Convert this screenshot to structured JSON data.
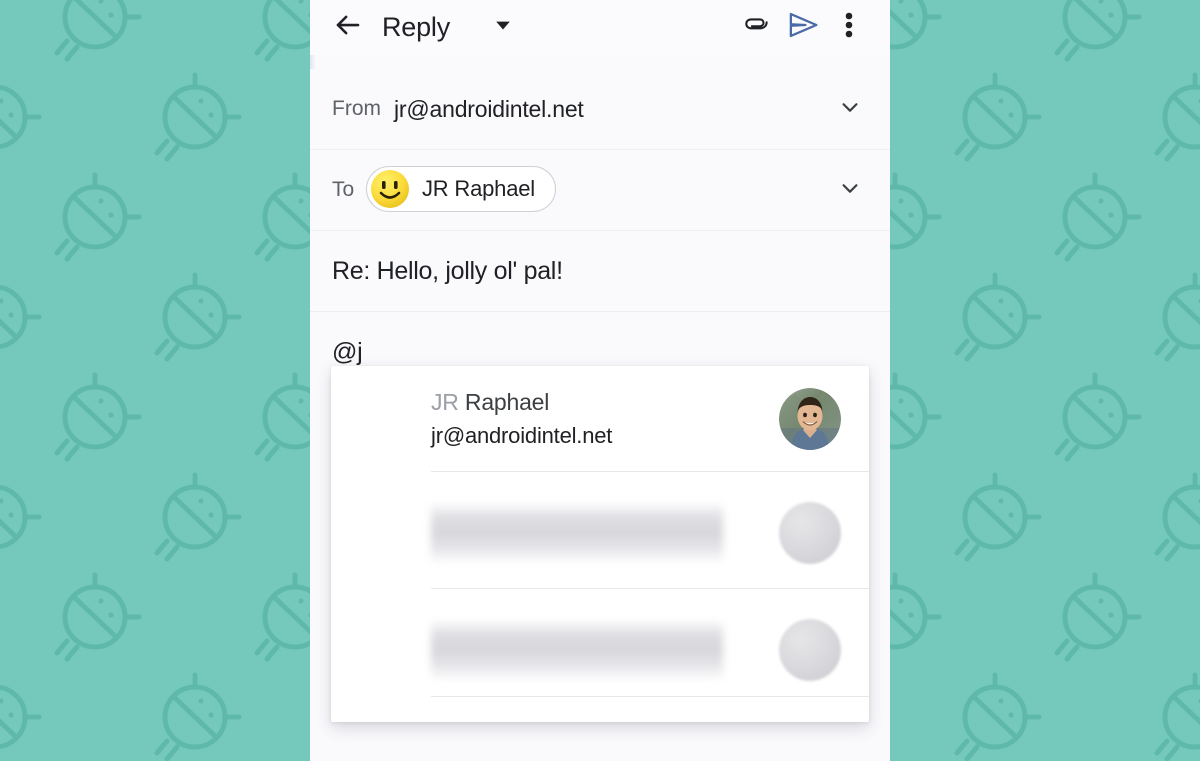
{
  "background": {
    "color": "#74c9bc",
    "pattern_icon": "android-bug-head-icon",
    "pattern_icon_color": "#5fb9ab"
  },
  "appbar": {
    "back_icon": "arrow-left-icon",
    "title": "Reply",
    "reply_type_caret_icon": "caret-down-icon",
    "attach_icon": "paperclip-icon",
    "send_icon": "send-paper-plane-icon",
    "overflow_icon": "more-vertical-icon",
    "send_color": "#4a6ba8"
  },
  "compose": {
    "from": {
      "label": "From",
      "value": "jr@androidintel.net",
      "expand_icon": "chevron-down-icon"
    },
    "to": {
      "label": "To",
      "chip_name": "JR Raphael",
      "chip_avatar_icon": "smiley-face-icon",
      "expand_icon": "chevron-down-icon"
    },
    "subject": {
      "value": "Re: Hello, jolly ol' pal!"
    },
    "body": {
      "value": "@j"
    }
  },
  "autocomplete": {
    "suggestions": [
      {
        "name_matched": "JR",
        "name_rest": " Raphael",
        "email": "jr@androidintel.net",
        "avatar": "profile-photo-jr-raphael",
        "blurred": false
      },
      {
        "name_matched": "",
        "name_rest": "",
        "email": "",
        "avatar": "blurred-avatar",
        "blurred": true
      },
      {
        "name_matched": "",
        "name_rest": "",
        "email": "",
        "avatar": "blurred-avatar",
        "blurred": true
      }
    ]
  }
}
